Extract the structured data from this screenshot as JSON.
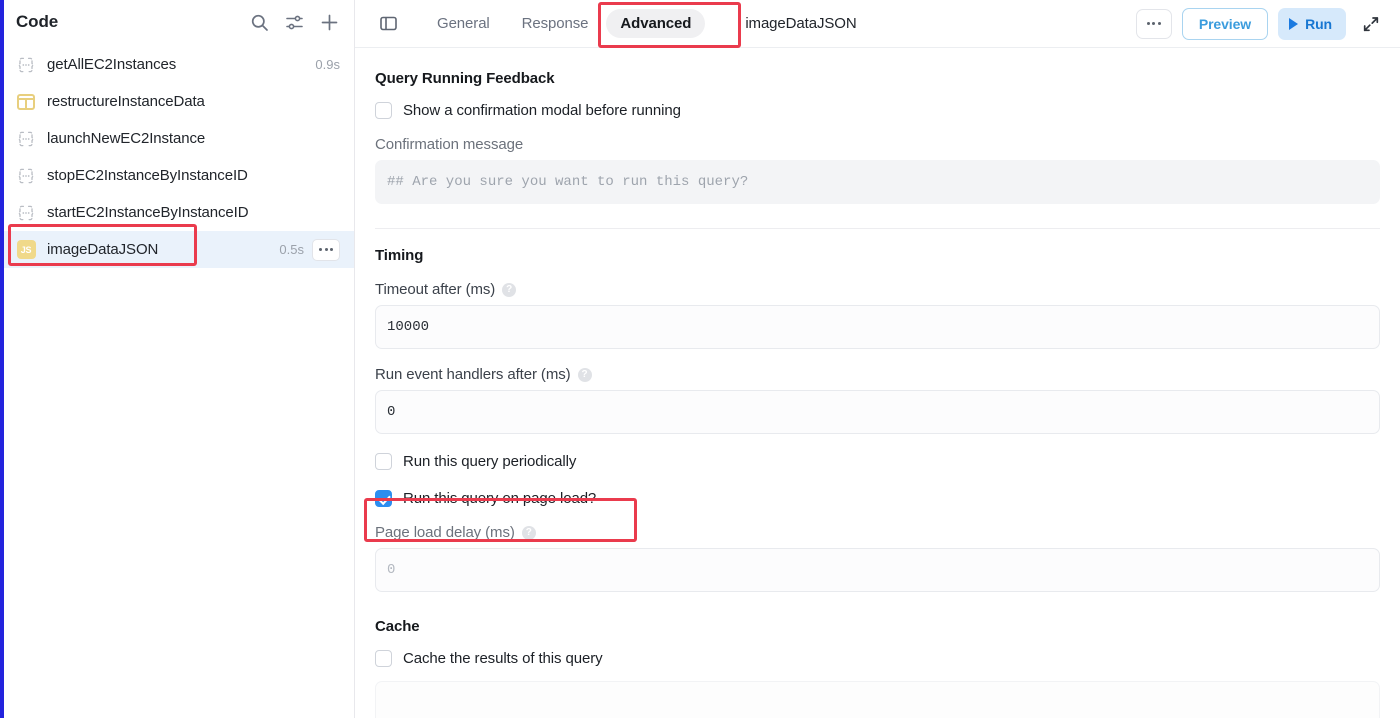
{
  "sidebar": {
    "title": "Code",
    "actions": [
      {
        "name": "search-icon",
        "label": "Search"
      },
      {
        "name": "filter-icon",
        "label": "Filter"
      },
      {
        "name": "add-icon",
        "label": "Add"
      }
    ],
    "items": [
      {
        "label": "getAllEC2Instances",
        "icon": "braces-icon",
        "time": "0.9s",
        "selected": false
      },
      {
        "label": "restructureInstanceData",
        "icon": "transformer-icon",
        "time": "",
        "selected": false
      },
      {
        "label": "launchNewEC2Instance",
        "icon": "braces-icon",
        "time": "",
        "selected": false
      },
      {
        "label": "stopEC2InstanceByInstanceID",
        "icon": "braces-icon",
        "time": "",
        "selected": false
      },
      {
        "label": "startEC2InstanceByInstanceID",
        "icon": "braces-icon",
        "time": "",
        "selected": false
      },
      {
        "label": "imageDataJSON",
        "icon": "js-icon",
        "time": "0.5s",
        "selected": true,
        "more": "..."
      }
    ]
  },
  "header": {
    "panel_toggle": "panel-toggle",
    "tabs": [
      {
        "label": "General",
        "active": false
      },
      {
        "label": "Response",
        "active": false
      },
      {
        "label": "Advanced",
        "active": true
      }
    ],
    "document_title": "imageDataJSON",
    "more_label": "...",
    "preview_label": "Preview",
    "run_label": "Run",
    "expand_label": "Expand"
  },
  "content": {
    "feedback": {
      "section_title": "Query Running Feedback",
      "confirm_checkbox_label": "Show a confirmation modal before running",
      "confirm_checkbox_checked": false,
      "confirm_message_label": "Confirmation message",
      "confirm_message_placeholder": "## Are you sure you want to run this query?",
      "confirm_message_value": ""
    },
    "timing": {
      "section_title": "Timing",
      "timeout_label": "Timeout after (ms)",
      "timeout_value": "10000",
      "event_handlers_label": "Run event handlers after (ms)",
      "event_handlers_value": "0",
      "periodic_label": "Run this query periodically",
      "periodic_checked": false,
      "page_load_label": "Run this query on page load?",
      "page_load_checked": true,
      "page_load_delay_label": "Page load delay (ms)",
      "page_load_delay_placeholder": "0",
      "page_load_delay_value": ""
    },
    "cache": {
      "section_title": "Cache",
      "cache_checkbox_label": "Cache the results of this query",
      "cache_checked": false
    },
    "help_glyph": "?"
  },
  "colors": {
    "accent_blue": "#2c8ef0",
    "run_bg": "#d6e9fb",
    "run_text": "#1877d2",
    "preview_text": "#3b9cdd",
    "annotation_red": "#ea3b4d",
    "selected_row": "#eaf2fb",
    "js_badge": "#f0d98a",
    "left_rail": "#2323dd"
  }
}
